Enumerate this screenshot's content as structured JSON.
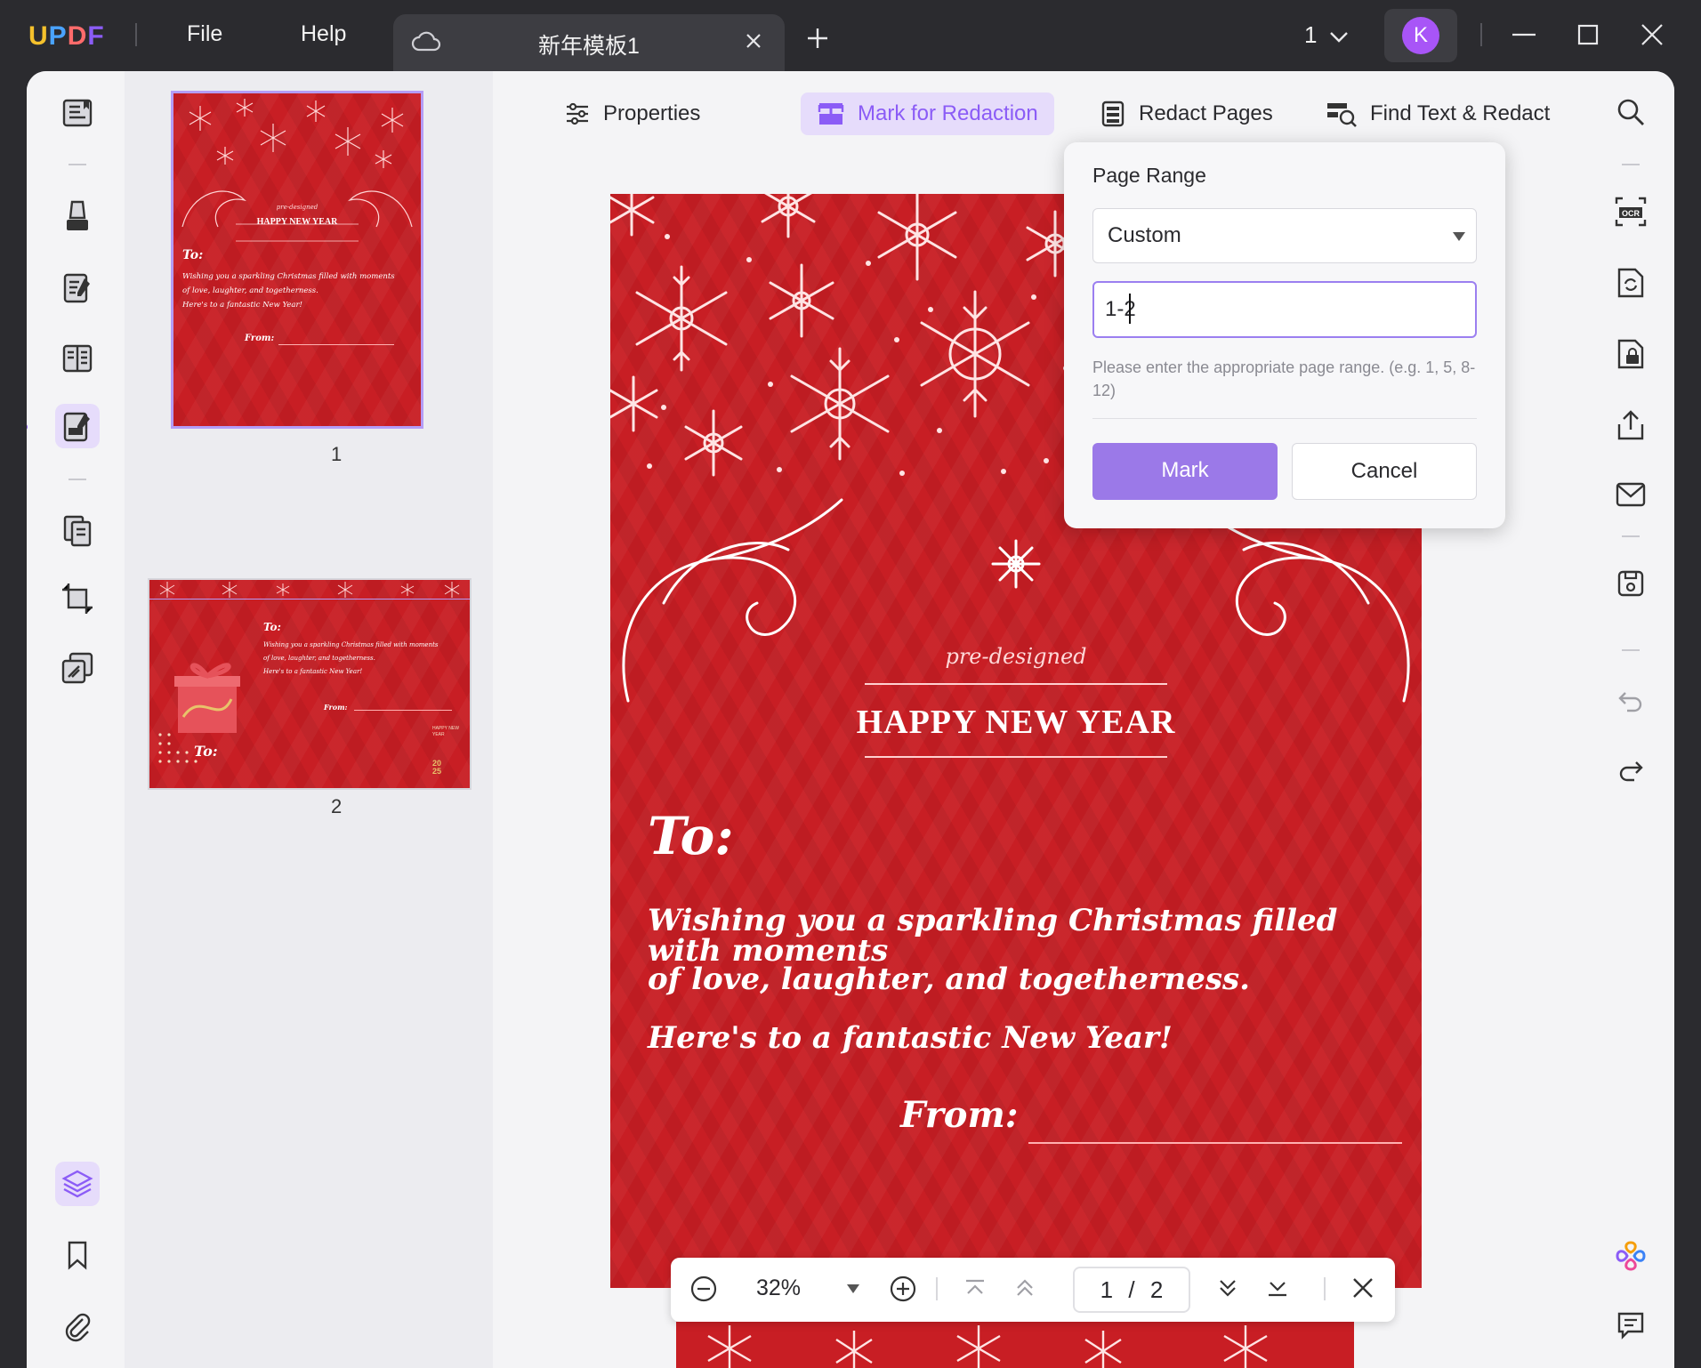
{
  "app": {
    "logo": "UPDF",
    "menu": [
      "File",
      "Help"
    ],
    "tab_title": "新年模板1",
    "page_indicator": "1",
    "avatar_initial": "K"
  },
  "toolbar": {
    "properties": "Properties",
    "mark_for_redaction": "Mark for Redaction",
    "redact_pages": "Redact Pages",
    "find_text_redact": "Find Text & Redact"
  },
  "thumbnails": [
    {
      "number": "1"
    },
    {
      "number": "2"
    }
  ],
  "page": {
    "pre_designed": "pre-designed",
    "heading": "HAPPY NEW YEAR",
    "to_label": "To:",
    "message_lines": [
      "Wishing you a sparkling Christmas filled with moments",
      "of love, laughter, and togetherness.",
      "Here's to a fantastic New Year!"
    ],
    "from_label": "From:"
  },
  "thumb2": {
    "to_label": "To:",
    "message_lines": [
      "Wishing you a sparkling Christmas filled with moments",
      "of love, laughter, and togetherness.",
      "Here's to a fantastic New Year!"
    ],
    "from_label": "From:",
    "gift_to": "To:",
    "badge_text": "HAPPY NEW YEAR",
    "badge_year": "20 25"
  },
  "zoom": {
    "percent": "32%",
    "current_page": "1",
    "separator": "/",
    "total_pages": "2"
  },
  "page_range_popup": {
    "title": "Page Range",
    "select_value": "Custom",
    "input_value": "1-2",
    "hint": "Please enter the appropriate page range. (e.g. 1, 5, 8-12)",
    "mark_button": "Mark",
    "cancel_button": "Cancel"
  },
  "colors": {
    "accent": "#8b5cf6",
    "accent_soft": "#e6dcfb",
    "card_red": "#c81e24",
    "titlebar": "#2b2b2f"
  }
}
